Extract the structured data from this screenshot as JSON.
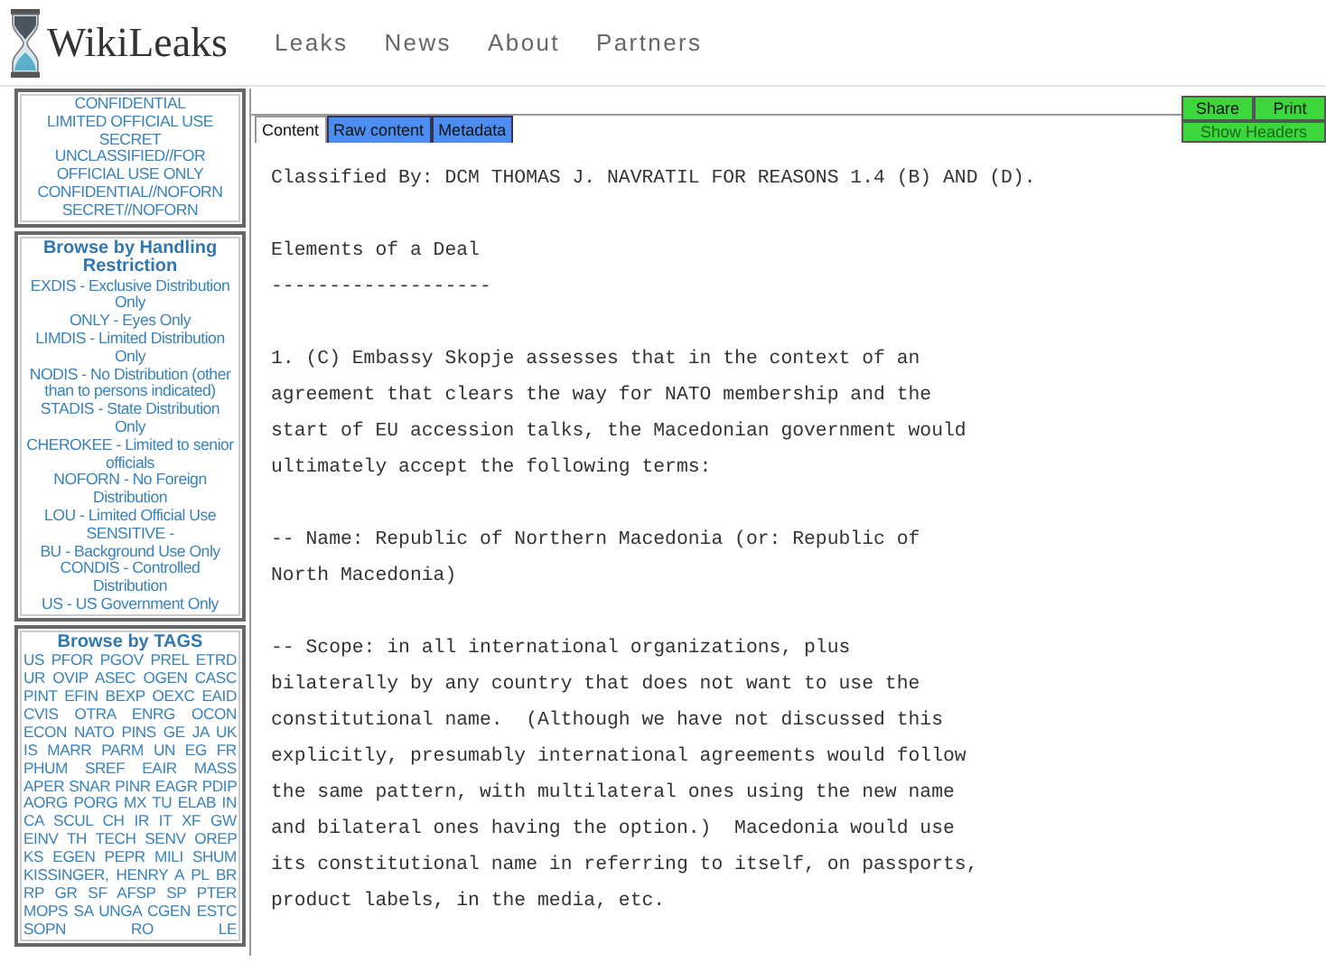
{
  "header": {
    "logo_text": "WikiLeaks",
    "nav": [
      "Leaks",
      "News",
      "About",
      "Partners"
    ]
  },
  "sidebar": {
    "classification_items": [
      "CONFIDENTIAL",
      "LIMITED OFFICIAL USE",
      "SECRET",
      "UNCLASSIFIED//FOR OFFICIAL USE ONLY",
      "CONFIDENTIAL//NOFORN",
      "SECRET//NOFORN"
    ],
    "handling": {
      "title": "Browse by Handling Restriction",
      "items": [
        "EXDIS - Exclusive Distribution Only",
        "ONLY - Eyes Only",
        "LIMDIS - Limited Distribution Only",
        "NODIS - No Distribution (other than to persons indicated)",
        "STADIS - State Distribution Only",
        "CHEROKEE - Limited to senior officials",
        "NOFORN - No Foreign Distribution",
        "LOU - Limited Official Use",
        "SENSITIVE -",
        "BU - Background Use Only",
        "CONDIS - Controlled Distribution",
        "US - US Government Only"
      ]
    },
    "tags": {
      "title": "Browse by TAGS",
      "items": [
        "US",
        "PFOR",
        "PGOV",
        "PREL",
        "ETRD",
        "UR",
        "OVIP",
        "ASEC",
        "OGEN",
        "CASC",
        "PINT",
        "EFIN",
        "BEXP",
        "OEXC",
        "EAID",
        "CVIS",
        "OTRA",
        "ENRG",
        "OCON",
        "ECON",
        "NATO",
        "PINS",
        "GE",
        "JA",
        "UK",
        "IS",
        "MARR",
        "PARM",
        "UN",
        "EG",
        "FR",
        "PHUM",
        "SREF",
        "EAIR",
        "MASS",
        "APER",
        "SNAR",
        "PINR",
        "EAGR",
        "PDIP",
        "AORG",
        "PORG",
        "MX",
        "TU",
        "ELAB",
        "IN",
        "CA",
        "SCUL",
        "CH",
        "IR",
        "IT",
        "XF",
        "GW",
        "EINV",
        "TH",
        "TECH",
        "SENV",
        "OREP",
        "KS",
        "EGEN",
        "PEPR",
        "MILI",
        "SHUM",
        "KISSINGER, HENRY A",
        "PL",
        "BR",
        "RP",
        "GR",
        "SF",
        "AFSP",
        "SP",
        "PTER",
        "MOPS",
        "SA",
        "UNGA",
        "CGEN",
        "ESTC",
        "SOPN",
        "RO",
        "LE"
      ]
    }
  },
  "tabs": [
    {
      "label": "Content",
      "selected": true
    },
    {
      "label": "Raw content",
      "selected": false
    },
    {
      "label": "Metadata",
      "selected": false
    }
  ],
  "actions": {
    "buttons": [
      "Share",
      "Print"
    ],
    "show_headers": "Show Headers"
  },
  "content": {
    "paragraphs": [
      [
        "Classified By: DCM THOMAS J. NAVRATIL FOR REASONS 1.4 (B) AND (D)."
      ],
      [
        "Elements of a Deal",
        "-------------------"
      ],
      [
        "1. (C) Embassy Skopje assesses that in the context of an",
        "agreement that clears the way for NATO membership and the",
        "start of EU accession talks, the Macedonian government would",
        "ultimately accept the following terms:"
      ],
      [
        "-- Name: Republic of Northern Macedonia (or: Republic of",
        "North Macedonia)"
      ],
      [
        "-- Scope: in all international organizations, plus",
        "bilaterally by any country that does not want to use the",
        "constitutional name.  (Although we have not discussed this",
        "explicitly, presumably international agreements would follow",
        "the same pattern, with multilateral ones using the new name",
        "and bilateral ones having the option.)  Macedonia would use",
        "its constitutional name in referring to itself, on passports,",
        "product labels, in the media, etc."
      ]
    ]
  }
}
